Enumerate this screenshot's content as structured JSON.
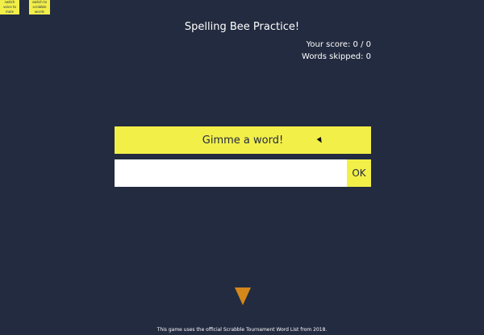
{
  "corner_buttons": {
    "voice_label": "switch voice to male",
    "words_label": "switch to scrabble words"
  },
  "header": {
    "title": "Spelling Bee Practice!"
  },
  "stats": {
    "score_text": "Your score: 0 / 0",
    "skipped_text": "Words skipped: 0"
  },
  "main": {
    "gimme_label": "Gimme a word!",
    "answer_value": "",
    "answer_placeholder": "",
    "ok_label": "OK"
  },
  "footer": {
    "text": "This game uses the official Scrabble Tournament Word List from 2018."
  },
  "colors": {
    "background": "#232b40",
    "accent": "#f2ef49",
    "arrow": "#d4871a"
  }
}
